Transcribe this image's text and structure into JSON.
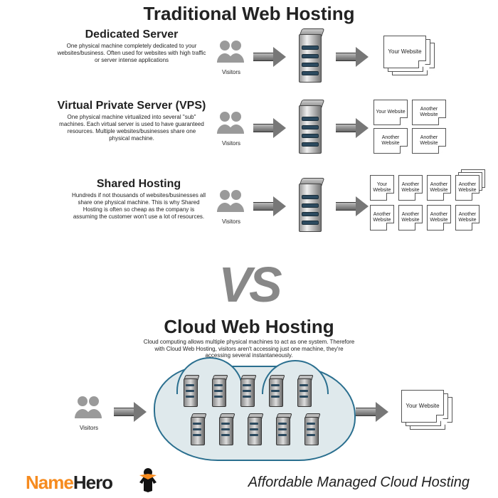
{
  "traditional_title": "Traditional Web Hosting",
  "vs_label": "VS",
  "cloud_title": "Cloud Web Hosting",
  "cloud_description": "Cloud computing allows multiple physical machines to act as one system.  Therefore with Cloud Web Hosting, visitors aren't accessing just one machine, they're accessing several instantaneously.",
  "visitors_label": "Visitors",
  "page_labels": {
    "your": "Your Website",
    "another": "Another Website"
  },
  "rows": {
    "dedicated": {
      "heading": "Dedicated Server",
      "desc": "One physical machine completely dedicated to your websites/business. Often used for websites with high traffic or server intense applications"
    },
    "vps": {
      "heading": "Virtual Private Server (VPS)",
      "desc": "One physical machine virtualized into several \"sub\" machines.  Each virtual server is used to have guaranteed resources. Multiple websites/businesses share one physical machine."
    },
    "shared": {
      "heading": "Shared Hosting",
      "desc": "Hundreds if not thousands of websites/businesses all share one physical machine.  This is why Shared Hosting is often so cheap as the company is assuming the customer won't use a lot of resources."
    }
  },
  "footer": {
    "logo_part1": "Name",
    "logo_part2": "Hero",
    "tagline": "Affordable Managed Cloud Hosting"
  }
}
